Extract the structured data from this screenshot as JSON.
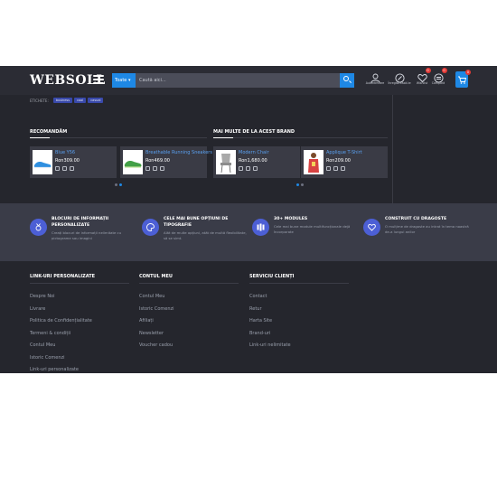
{
  "header": {
    "logo": "WEBSOLL",
    "search": {
      "category": "Toate",
      "placeholder": "Caută aici..."
    },
    "icons": [
      {
        "name": "account-icon",
        "label": "Autentificare",
        "badge": ""
      },
      {
        "name": "register-icon",
        "label": "Înregistrează-te",
        "badge": ""
      },
      {
        "name": "wishlist-icon",
        "label": "Wishlist",
        "badge": "0"
      },
      {
        "name": "compare-icon",
        "label": "Compară",
        "badge": "0"
      }
    ],
    "cart_badge": "0"
  },
  "tags": {
    "label": "ETICHETE:",
    "items": [
      "business",
      "cool",
      "casual"
    ]
  },
  "sections": [
    {
      "title": "RECOMANDĂM",
      "products": [
        {
          "name": "Blue Y56",
          "price": "Ron309.00",
          "thumb_color": "#2f8fe0"
        },
        {
          "name": "Breathable Running Sneakers",
          "price": "Ron469.00",
          "thumb_color": "#43a047"
        }
      ]
    },
    {
      "title": "MAI MULTE DE LA ACEST BRAND",
      "products": [
        {
          "name": "Modern Chair",
          "price": "Ron1,680.00",
          "thumb_color": "#9e9e9e"
        },
        {
          "name": "Applique T-Shirt",
          "price": "Ron209.00",
          "thumb_color": "#d84343"
        }
      ]
    }
  ],
  "features": [
    {
      "title": "BLOCURI DE INFORMAȚII PERSONALIZATE",
      "desc": "Creați blocuri de informații nelimitate cu pictograme sau imagini",
      "icon": "medal-icon"
    },
    {
      "title": "CELE MAI BUNE OPȚIUNI DE TIPOGRAFIE",
      "desc": "Alăt de multe opțiuni, atât de multă flexibilitate, să se simt.",
      "icon": "palette-icon"
    },
    {
      "title": "30+ MODULES",
      "desc": "Cele mai bune module multifuncționale dejă încorporate",
      "icon": "modules-icon"
    },
    {
      "title": "CONSTRUIT CU DRAGOSTE",
      "desc": "O mulțime de dragoste au intrat în tema noastră de-a lungul anilor",
      "icon": "heart-icon"
    }
  ],
  "footer": {
    "columns": [
      {
        "title": "LINK-URI PERSONALIZATE",
        "links": [
          "Despre Noi",
          "Livrare",
          "Politica de Confidențialitate",
          "Termeni & condiții",
          "Contul Meu",
          "Istoric Comenzi",
          "Link-uri personalizate"
        ]
      },
      {
        "title": "CONTUL MEU",
        "links": [
          "Contul Meu",
          "Istoric Comenzi",
          "Afiliați",
          "Newsletter",
          "Voucher cadou"
        ]
      },
      {
        "title": "SERVICIU CLIENȚI",
        "links": [
          "Contact",
          "Retur",
          "Harta Site",
          "Brand-uri",
          "Link-uri nelimitate"
        ]
      }
    ]
  },
  "colors": {
    "accent": "#1e88e5",
    "header_bg": "#2b2c34",
    "content_bg": "#25262d",
    "features_bg": "#3a3c48",
    "badge": "#e53935",
    "product_link": "#5aa0f0"
  }
}
